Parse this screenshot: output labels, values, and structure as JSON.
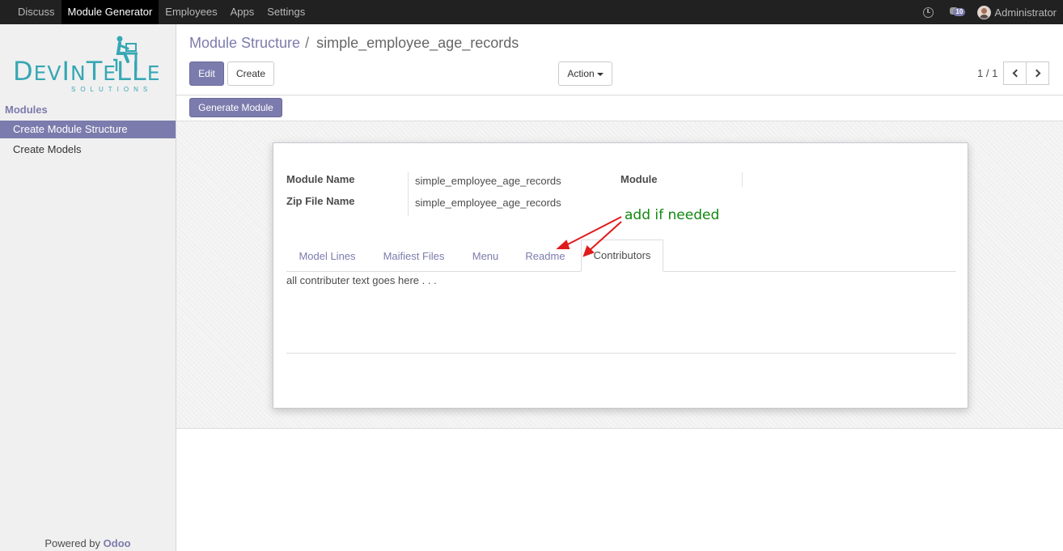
{
  "topbar": {
    "menu": [
      "Discuss",
      "Module Generator",
      "Employees",
      "Apps",
      "Settings"
    ],
    "active_index": 1,
    "chat_count": "10",
    "user": "Administrator",
    "icons": [
      "clock-icon",
      "chat-icon",
      "avatar"
    ]
  },
  "sidebar": {
    "logo_text": "DevIntelle",
    "logo_main_a": "D",
    "logo_main_b": "EV",
    "logo_main_c": "I",
    "logo_main_d": "N",
    "logo_main_e": "T",
    "logo_main_f": "E",
    "logo_main_g": "LL",
    "logo_main_h": "E",
    "logo_sub": "SOLUTIONS",
    "section_title": "Modules",
    "items": [
      {
        "label": "Create Module Structure",
        "active": true
      },
      {
        "label": "Create Models",
        "active": false
      }
    ],
    "powered_prefix": "Powered by",
    "powered_brand": "Odoo"
  },
  "control": {
    "breadcrumb_parent": "Module Structure",
    "breadcrumb_sep": "/",
    "breadcrumb_current": "simple_employee_age_records",
    "edit_label": "Edit",
    "create_label": "Create",
    "action_label": "Action",
    "pager": "1 / 1"
  },
  "statusbar": {
    "generate_label": "Generate Module"
  },
  "form": {
    "module_name_label": "Module Name",
    "module_name_value": "simple_employee_age_records",
    "zip_label": "Zip File Name",
    "zip_value": "simple_employee_age_records",
    "module_label": "Module",
    "tabs": [
      "Model Lines",
      "Maifiest Files",
      "Menu",
      "Readme",
      "Contributors"
    ],
    "active_tab": 4,
    "tab_content": "all contributer text goes here . . ."
  },
  "annotation": {
    "text": "add if needed",
    "color": "#118811",
    "arrow_color": "#e01b1b"
  },
  "colors": {
    "accent": "#7c7bad",
    "topbar": "#212121",
    "logo": "#37a7b4"
  }
}
